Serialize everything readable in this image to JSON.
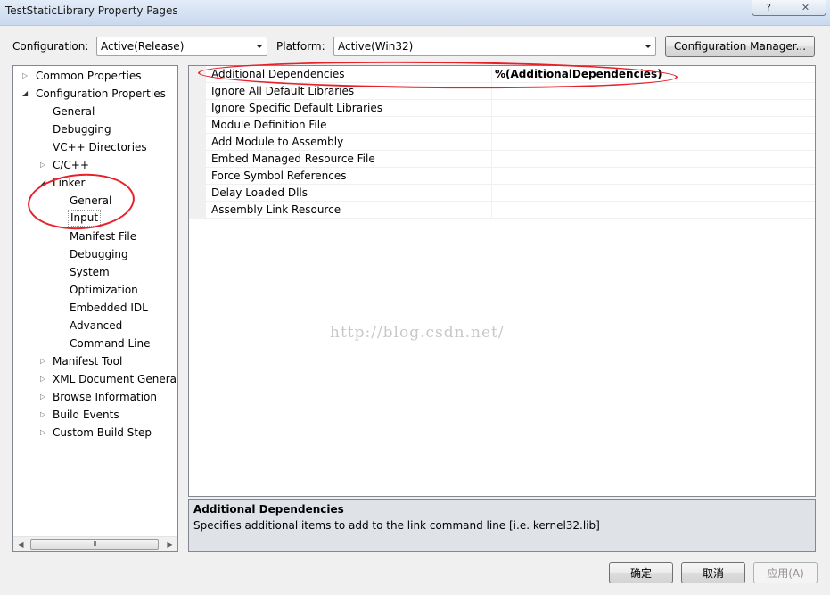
{
  "window": {
    "title": "TestStaticLibrary Property Pages",
    "help_label": "?",
    "close_label": "✕"
  },
  "config": {
    "configuration_label": "Configuration:",
    "configuration_value": "Active(Release)",
    "platform_label": "Platform:",
    "platform_value": "Active(Win32)",
    "manager_label": "Configuration Manager..."
  },
  "tree": {
    "common": "Common Properties",
    "config": "Configuration Properties",
    "general": "General",
    "debugging": "Debugging",
    "vcdirs": "VC++ Directories",
    "cpp": "C/C++",
    "linker": "Linker",
    "linker_general": "General",
    "linker_input": "Input",
    "linker_manifest": "Manifest File",
    "linker_debugging": "Debugging",
    "linker_system": "System",
    "linker_optimization": "Optimization",
    "linker_embedded_idl": "Embedded IDL",
    "linker_advanced": "Advanced",
    "linker_cmdline": "Command Line",
    "manifest_tool": "Manifest Tool",
    "xml_doc": "XML Document Generat",
    "browse_info": "Browse Information",
    "build_events": "Build Events",
    "custom_build": "Custom Build Step",
    "scroll_grip": "III"
  },
  "properties": [
    {
      "name": "Additional Dependencies",
      "value": "%(AdditionalDependencies)"
    },
    {
      "name": "Ignore All Default Libraries",
      "value": ""
    },
    {
      "name": "Ignore Specific Default Libraries",
      "value": ""
    },
    {
      "name": "Module Definition File",
      "value": ""
    },
    {
      "name": "Add Module to Assembly",
      "value": ""
    },
    {
      "name": "Embed Managed Resource File",
      "value": ""
    },
    {
      "name": "Force Symbol References",
      "value": ""
    },
    {
      "name": "Delay Loaded Dlls",
      "value": ""
    },
    {
      "name": "Assembly Link Resource",
      "value": ""
    }
  ],
  "description": {
    "title": "Additional Dependencies",
    "text": "Specifies additional items to add to the link command line [i.e. kernel32.lib]"
  },
  "watermark": "http://blog.csdn.net/",
  "buttons": {
    "ok": "确定",
    "cancel": "取消",
    "apply": "应用(A)"
  },
  "colors": {
    "annotation": "#e8202a",
    "window_title_gradient": "#c9d9ee"
  }
}
